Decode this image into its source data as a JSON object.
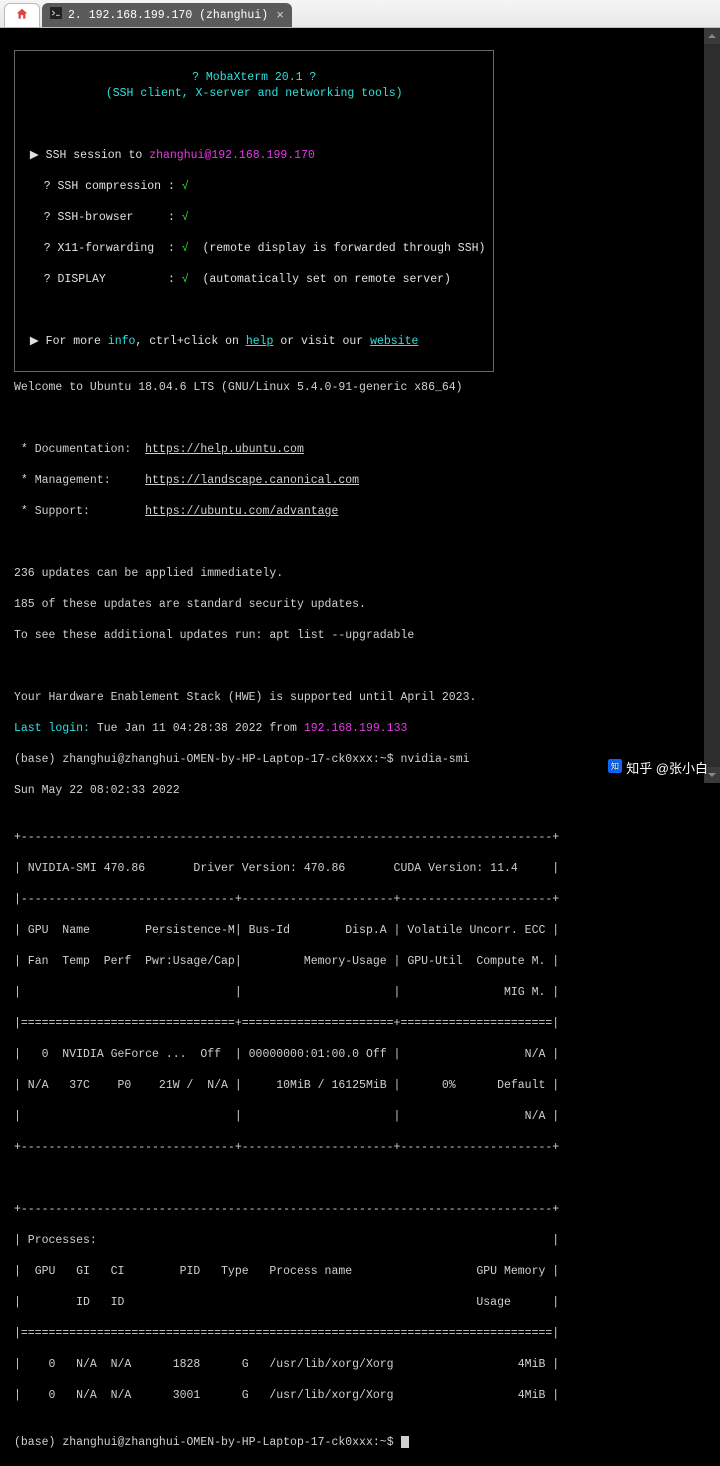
{
  "tab": {
    "home_icon": "home-icon",
    "title": "2. 192.168.199.170 (zhanghui)"
  },
  "banner": {
    "title": "? MobaXterm 20.1 ?",
    "subtitle": "(SSH client, X-server and networking tools)",
    "session_prefix": "SSH session to ",
    "user": "zhanghui",
    "at": "@",
    "host": "192.168.199.170",
    "l1_label": "? SSH compression :",
    "l2_label": "? SSH-browser     :",
    "l3_label": "? X11-forwarding  :",
    "l3_note": "(remote display is forwarded through SSH)",
    "l4_label": "? DISPLAY         :",
    "l4_note": "(automatically set on remote server)",
    "footer_prefix": "For more ",
    "info": "info",
    "footer_mid": ", ctrl+click on ",
    "help": "help",
    "footer_mid2": " or visit our ",
    "website": "website",
    "check": "√"
  },
  "motd": {
    "welcome": "Welcome to Ubuntu 18.04.6 LTS (GNU/Linux 5.4.0-91-generic x86_64)",
    "doc_label": " * Documentation:  ",
    "doc_url": "https://help.ubuntu.com",
    "mgmt_label": " * Management:     ",
    "mgmt_url": "https://landscape.canonical.com",
    "sup_label": " * Support:        ",
    "sup_url": "https://ubuntu.com/advantage",
    "upd1": "236 updates can be applied immediately.",
    "upd2": "185 of these updates are standard security updates.",
    "upd3": "To see these additional updates run: apt list --upgradable",
    "hwe": "Your Hardware Enablement Stack (HWE) is supported until April 2023.",
    "lastlogin_label": "Last login:",
    "lastlogin_rest": " Tue Jan 11 04:28:38 2022 from ",
    "lastlogin_ip": "192.168.199.133"
  },
  "prompt1": {
    "env": "(base) ",
    "userhost": "zhanghui@zhanghui-OMEN-by-HP-Laptop-17-ck0xxx",
    "sep": ":",
    "path": "~",
    "dollar": "$ ",
    "cmd": "nvidia-smi"
  },
  "smi": {
    "date": "Sun May 22 08:02:33 2022",
    "top": "+-----------------------------------------------------------------------------+",
    "h1": "| NVIDIA-SMI 470.86       Driver Version: 470.86       CUDA Version: 11.4     |",
    "sep1": "|-------------------------------+----------------------+----------------------+",
    "h2a": "| GPU  Name        Persistence-M| Bus-Id        Disp.A | Volatile Uncorr. ECC |",
    "h2b": "| Fan  Temp  Perf  Pwr:Usage/Cap|         Memory-Usage | GPU-Util  Compute M. |",
    "h2c": "|                               |                      |               MIG M. |",
    "sep2": "|===============================+======================+======================|",
    "r1a": "|   0  NVIDIA GeForce ...  Off  | 00000000:01:00.0 Off |                  N/A |",
    "r1b": "| N/A   37C    P0    21W /  N/A |     10MiB / 16125MiB |      0%      Default |",
    "r1c": "|                               |                      |                  N/A |",
    "bot1": "+-------------------------------+----------------------+----------------------+",
    "ptop": "+-----------------------------------------------------------------------------+",
    "p1": "| Processes:                                                                  |",
    "p2": "|  GPU   GI   CI        PID   Type   Process name                  GPU Memory |",
    "p3": "|        ID   ID                                                   Usage      |",
    "psep": "|=============================================================================|",
    "pr1": "|    0   N/A  N/A      1828      G   /usr/lib/xorg/Xorg                  4MiB |",
    "pr2": "|    0   N/A  N/A      3001      G   /usr/lib/xorg/Xorg                  4MiB |"
  },
  "prompt2": {
    "env": "(base) ",
    "userhost": "zhanghui@zhanghui-OMEN-by-HP-Laptop-17-ck0xxx",
    "sep": ":",
    "path": "~",
    "dollar": "$ "
  },
  "watermark": "知乎 @张小白"
}
